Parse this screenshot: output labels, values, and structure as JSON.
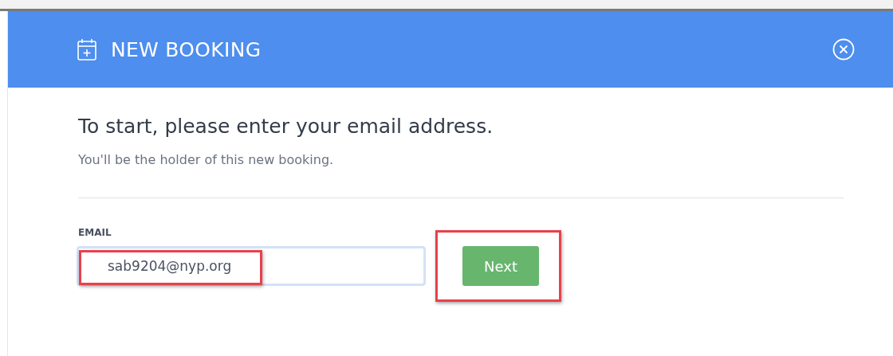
{
  "dialog": {
    "title": "NEW BOOKING"
  },
  "heading": "To start, please enter your email address.",
  "subheading": "You'll be the holder of this new booking.",
  "email_field": {
    "label": "EMAIL",
    "value": "sab9204@nyp.org",
    "highlighted": true
  },
  "next_button": {
    "label": "Next",
    "highlighted": true
  }
}
